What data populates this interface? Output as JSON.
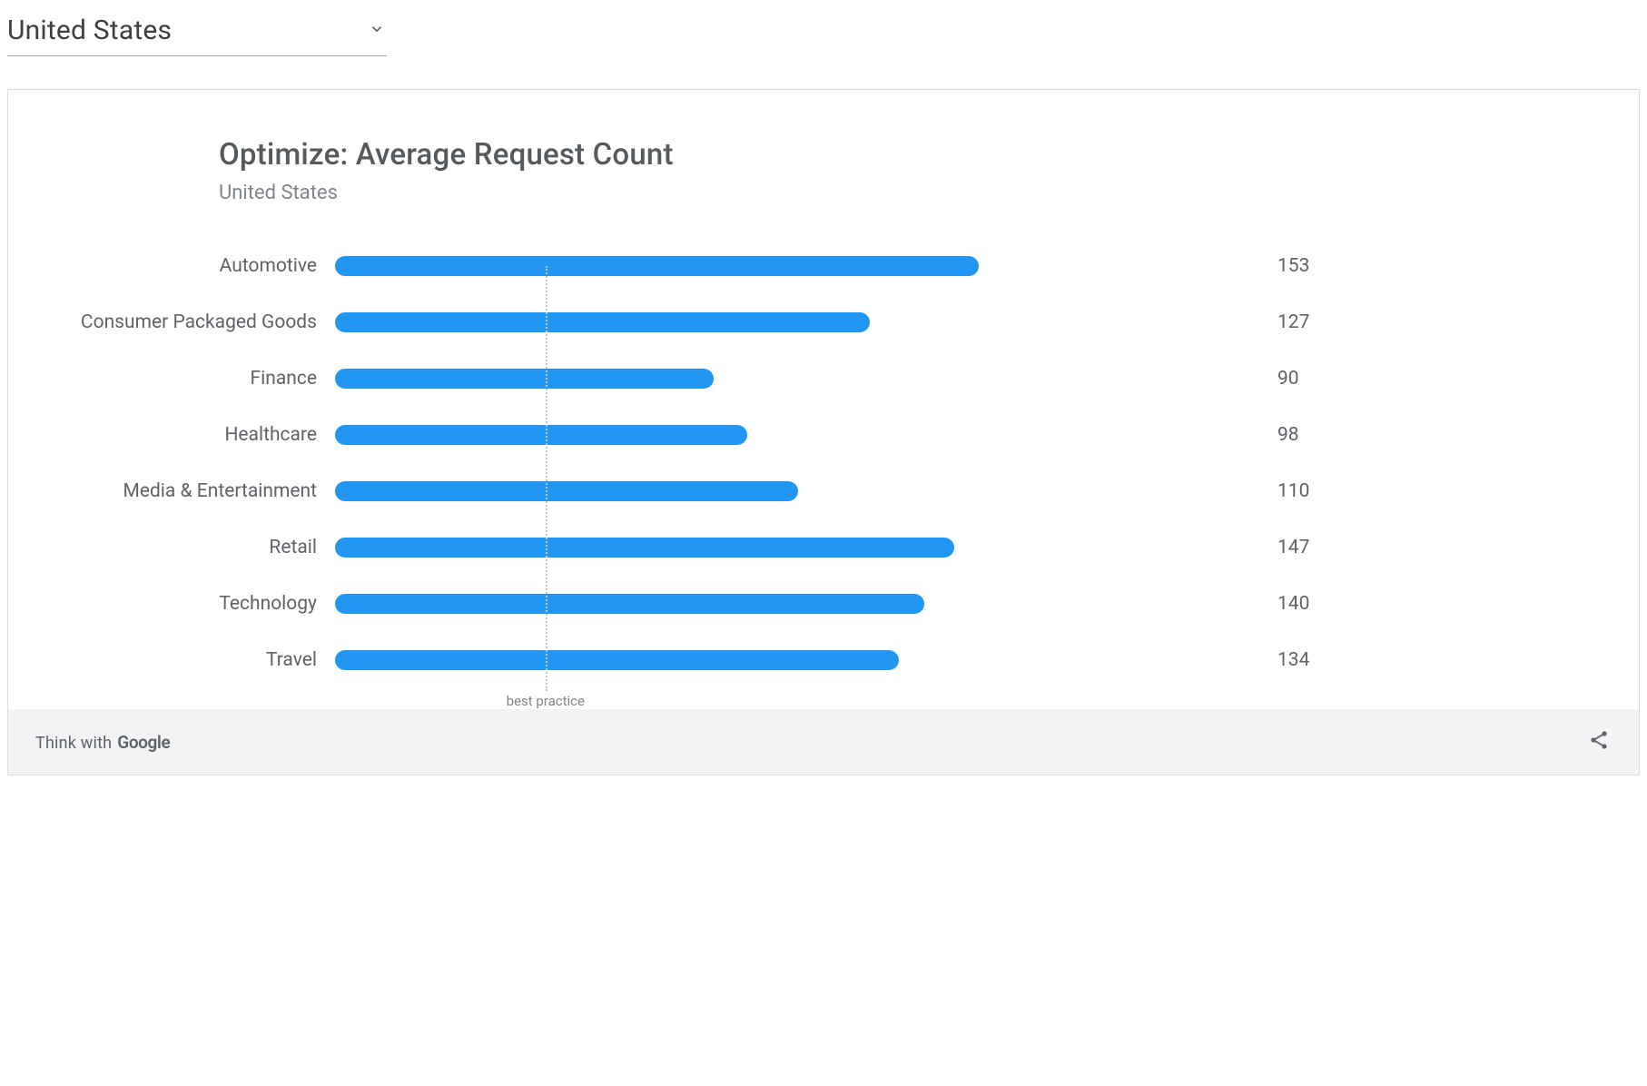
{
  "dropdown": {
    "selected": "United States"
  },
  "chart": {
    "title": "Optimize: Average Request Count",
    "subtitle": "United States",
    "best_practice_label": "best practice"
  },
  "footer": {
    "prefix": "Think with",
    "brand": "Google"
  },
  "chart_data": {
    "type": "bar",
    "orientation": "horizontal",
    "title": "Optimize: Average Request Count",
    "subtitle": "United States",
    "categories": [
      "Automotive",
      "Consumer Packaged Goods",
      "Finance",
      "Healthcare",
      "Media & Entertainment",
      "Retail",
      "Technology",
      "Travel"
    ],
    "values": [
      153,
      127,
      90,
      98,
      110,
      147,
      140,
      134
    ],
    "xlim": [
      0,
      220
    ],
    "reference_lines": [
      {
        "value": 50,
        "label": "best practice"
      }
    ],
    "bar_color": "#2196f3"
  }
}
